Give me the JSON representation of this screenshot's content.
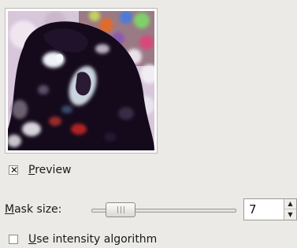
{
  "preview_checkbox": {
    "label_mnemonic": "P",
    "label_rest": "review",
    "checked": true,
    "check_glyph": "✕"
  },
  "mask_size": {
    "label_mnemonic": "M",
    "label_rest": "ask size:",
    "value": "7",
    "slider_fraction": 0.12
  },
  "spin_buttons": {
    "up": "▲",
    "down": "▼"
  },
  "intensity_checkbox": {
    "label_mnemonic": "U",
    "label_rest": "se intensity algorithm",
    "checked": false
  }
}
